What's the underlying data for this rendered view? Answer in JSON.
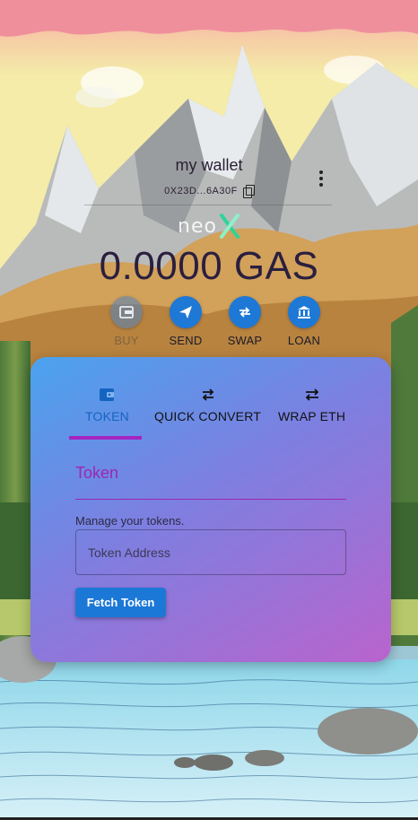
{
  "wallet": {
    "name": "my wallet",
    "address": "0X23D...6A30F",
    "network_logo_text": "neo",
    "balance": "0.0000 GAS"
  },
  "actions": [
    {
      "label": "BUY",
      "icon": "buy-icon",
      "enabled": false
    },
    {
      "label": "SEND",
      "icon": "send-icon",
      "enabled": true
    },
    {
      "label": "SWAP",
      "icon": "swap-icon",
      "enabled": true
    },
    {
      "label": "LOAN",
      "icon": "bank-icon",
      "enabled": true
    }
  ],
  "tabs": [
    {
      "label": "TOKEN",
      "icon": "wallet-icon",
      "active": true
    },
    {
      "label": "QUICK CONVERT",
      "icon": "convert-icon",
      "active": false
    },
    {
      "label": "WRAP ETH",
      "icon": "wrap-icon",
      "active": false
    }
  ],
  "token_panel": {
    "title": "Token",
    "helper": "Manage your tokens.",
    "input_placeholder": "Token Address",
    "input_value": "",
    "fetch_label": "Fetch Token"
  },
  "colors": {
    "primary": "#1c78d6",
    "accent": "#9c27b0",
    "card_gradient_start": "#4aa3ee",
    "card_gradient_end": "#b964cd",
    "neo_green": "#2fd39a"
  }
}
